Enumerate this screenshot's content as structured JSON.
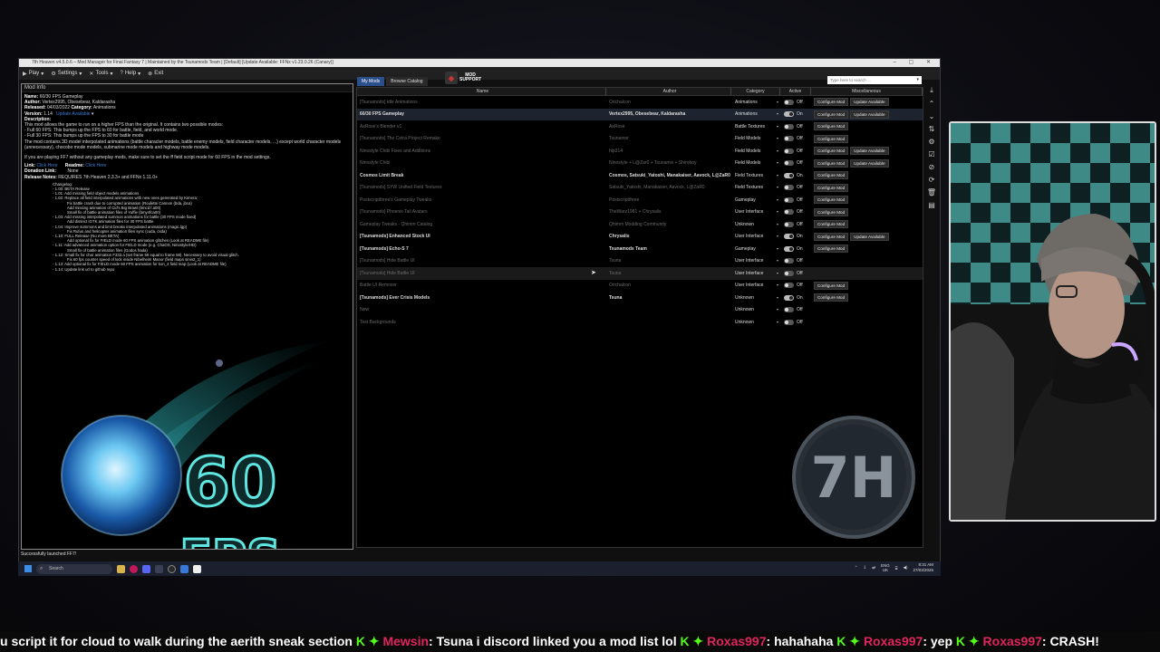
{
  "window": {
    "title": "7th Heaven v4.5.0.6 – Mod Manager for Final Fantasy 7 | Maintained by the Tsunamods Team | [Default] [Update Available: FFNx v1.23.0.26 (Canary)]",
    "menu": [
      {
        "icon": "play-icon",
        "glyph": "▶",
        "label": "Play"
      },
      {
        "icon": "gear-icon",
        "glyph": "⚙",
        "label": "Settings"
      },
      {
        "icon": "tools-icon",
        "glyph": "✕",
        "label": "Tools"
      },
      {
        "icon": "help-icon",
        "glyph": "?",
        "label": "Help"
      },
      {
        "icon": "exit-icon",
        "glyph": "⊗",
        "label": "Exit"
      }
    ]
  },
  "mod_info": {
    "header": "Mod Info",
    "name_label": "Name:",
    "name": "60/30 FPS Gameplay",
    "author_label": "Author:",
    "author": "Vertex2995, Obesebear, Kaldarasha",
    "released_label": "Released:",
    "released": "04/03/2022",
    "category_label": "Category:",
    "category": "Animations",
    "version_label": "Version:",
    "version": "1.14",
    "update": "Update Available",
    "description_label": "Description:",
    "description": [
      "This mod allows the game to run on a higher FPS than the original. It contains two possible modes:",
      "- Full 60 FPS: This bumps up the FPS to 60 for battle, field, and world mode.",
      "- Full 30 FPS: This bumps up the FPS to 30 for battle mode",
      "The mod contains 3D model interpolated animations (battle character models, battle enemy models, field character models, ...) except world character models (unnecessary), chocobo mode models, submarine mode models and highway mode models.",
      "",
      "If you are playing FF7 without any gameplay mods, make sure to set the ff field script mode for 60 FPS in the mod settings."
    ],
    "link_label": "Link:",
    "link": "Click Here",
    "readme_label": "Readme:",
    "readme": "Click Here",
    "donation_label": "Donation Link:",
    "donation": "None",
    "notes_label": "Release Notes:",
    "notes": "REQUIRES 7th Heaven 2.3.3+ and FFNx 1.11.0+",
    "changelog_title": "Changelog:",
    "changelog": [
      {
        "t": "- 1.00: BETA Release",
        "sub": false
      },
      {
        "t": "- 1.01: Add missing field object models animations",
        "sub": false
      },
      {
        "t": "- 1.02: Replace all field interpolated animations with new ones generated by Kimera;",
        "sub": false
      },
      {
        "t": "Fix battle crash due to corrupted animation (Roulette Cannon (bda, jbca)",
        "sub": true
      },
      {
        "t": "Add missing animation of Cid's Big Brawl (bmcd f.a00)",
        "sub": true
      },
      {
        "t": "Small fix of battle animation files of Yuffie (bmy4fca00)",
        "sub": true
      },
      {
        "t": "- 1.03: Add missing interpolated summon animations for battle (30 FPS mode fixed)",
        "sub": false
      },
      {
        "t": "Add distinct IGTK animation files for 30 FPS battle",
        "sub": true
      },
      {
        "t": "- 1.04: Improve summons and limit breaks interpolated animations (magic.lgp)",
        "sub": false
      },
      {
        "t": "Fix Rufus and helicopter animation files sync (cuda, csda)",
        "sub": true
      },
      {
        "t": "- 1.10: FULL Release (No more BETA)",
        "sub": false
      },
      {
        "t": "Add optional fix for FIELD mode 60 FPS animation glitches (Look at README file)",
        "sub": true
      },
      {
        "t": "- 1.11: Add advanced animation option for FIELD mode (e.g. ChaOS, Ninostyle/HD)",
        "sub": false
      },
      {
        "t": "Small fix of battle animation files (Godos hada)",
        "sub": true
      },
      {
        "t": "- 1.12: Small fix for char animation F333.a (set frame 59 equal to frame 58). Necessary to avoid visual glitch.",
        "sub": false
      },
      {
        "t": "Fix 60 fps counter speed of lock inside Nibelheim Manor (field maps sinin2_1)",
        "sub": true
      },
      {
        "t": "- 1.13: Add optional fix for FIELD mode 60 FPS animation for kon_4 field map (Look at README file)",
        "sub": false
      },
      {
        "t": "- 1.14: Update link url to github repo",
        "sub": false
      }
    ],
    "art_text_top": "60",
    "art_text_bottom": "FPS"
  },
  "status": "Successfully launched FF7!",
  "tabs": [
    {
      "label": "My Mods",
      "active": true
    },
    {
      "label": "Browse Catalog",
      "active": false
    }
  ],
  "support": {
    "line1": "MOD",
    "line2": "SUPPORT"
  },
  "search": {
    "placeholder": "Type here to search ..."
  },
  "columns": {
    "name": "Name",
    "author": "Author",
    "category": "Category",
    "active": "Active",
    "misc": "Miscellaneous"
  },
  "rows": [
    {
      "name": "[Tsunamods] Idle Animations",
      "author": "Orichalcon",
      "category": "Animations",
      "on": false,
      "state": "Off",
      "configure": true,
      "update": true
    },
    {
      "name": "60/30 FPS Gameplay",
      "author": "Vertex2995, Obesebear, Kaldarasha",
      "category": "Animations",
      "on": true,
      "state": "On",
      "configure": true,
      "update": true,
      "selected": true
    },
    {
      "name": "AxRose's Blender v1",
      "author": "AxRose",
      "category": "Battle Textures",
      "on": false,
      "state": "Off",
      "configure": true,
      "update": false
    },
    {
      "name": "[Tsunamods] The Cetra Project Remake",
      "author": "Tsunamor",
      "category": "Field Models",
      "on": false,
      "state": "Off",
      "configure": true,
      "update": false
    },
    {
      "name": "Ninostyle Chibi Fixes and Additions",
      "author": "hip314",
      "category": "Field Models",
      "on": false,
      "state": "Off",
      "configure": true,
      "update": true
    },
    {
      "name": "Ninostyle Chibi",
      "author": "Ninostyle + L@Zar0 + Tsunamix + Shiroboy",
      "category": "Field Models",
      "on": false,
      "state": "Off",
      "configure": true,
      "update": true
    },
    {
      "name": "Cosmos Limit Break",
      "author": "Cosmos, Satsuki_Yatoshi, Manakaiser, Aavock, L@ZaR0",
      "category": "Field Textures",
      "on": true,
      "state": "On",
      "configure": true,
      "update": false
    },
    {
      "name": "[Tsunamods] SYW Unified Field Textures",
      "author": "Satsuki_Yatoshi, Manakaiser, Aavock, L@ZaR0",
      "category": "Field Textures",
      "on": false,
      "state": "Off",
      "configure": true,
      "update": false
    },
    {
      "name": "Postscriptthree's Gameplay Tweaks",
      "author": "Postscriptthree",
      "category": "Gameplay",
      "on": false,
      "state": "Off",
      "configure": true,
      "update": false
    },
    {
      "name": "[Tsunamods] Phoenix Tail Avatars",
      "author": "TheWarz1981 + Chrysalis",
      "category": "User Interface",
      "on": false,
      "state": "Off",
      "configure": true,
      "update": false
    },
    {
      "name": "Gameplay Tweaks - Qhimm Catalog",
      "author": "Qhimm Modding Community",
      "category": "Unknown",
      "on": false,
      "state": "Off",
      "configure": true,
      "update": false
    },
    {
      "name": "[Tsunamods] Enhanced Stock UI",
      "author": "Chrysalis",
      "category": "User Interface",
      "on": true,
      "state": "On",
      "configure": true,
      "update": true
    },
    {
      "name": "[Tsunamods] Echo-S 7",
      "author": "Tsunamods Team",
      "category": "Gameplay",
      "on": true,
      "state": "On",
      "configure": true,
      "update": false
    },
    {
      "name": "[Tsunamods] Hide Battle UI",
      "author": "Tsuna",
      "category": "User Interface",
      "on": false,
      "state": "Off",
      "configure": false,
      "update": false
    },
    {
      "name": "[Tsunamods] Hide Battle UI",
      "author": "Tsuna",
      "category": "User Interface",
      "on": false,
      "state": "Off",
      "configure": false,
      "update": false,
      "hover": true
    },
    {
      "name": "Battle UI Remover",
      "author": "Orichalcon",
      "category": "User Interface",
      "on": false,
      "state": "Off",
      "configure": true,
      "update": false
    },
    {
      "name": "[Tsunamods] Ever Crisis Models",
      "author": "Tsuna",
      "category": "Unknown",
      "on": true,
      "state": "On",
      "configure": true,
      "update": false
    },
    {
      "name": "New",
      "author": "",
      "category": "Unknown",
      "on": false,
      "state": "Off",
      "configure": false,
      "update": false
    },
    {
      "name": "Test Backgrounds",
      "author": "",
      "category": "Unknown",
      "on": false,
      "state": "Off",
      "configure": false,
      "update": false
    }
  ],
  "labels": {
    "configure": "Configure Mod",
    "update": "Update Available"
  },
  "side_icons": [
    {
      "name": "download-icon",
      "glyph": "⤓"
    },
    {
      "name": "up-arrow-icon",
      "glyph": "⌃"
    },
    {
      "name": "down-arrow-icon",
      "glyph": "⌄"
    },
    {
      "name": "sort-icon",
      "glyph": "⇅"
    },
    {
      "name": "settings-icon",
      "glyph": "⚙"
    },
    {
      "name": "check-icon",
      "glyph": "☑"
    },
    {
      "name": "block-icon",
      "glyph": "⊘"
    },
    {
      "name": "refresh-icon",
      "glyph": "⟳"
    },
    {
      "name": "delete-icon",
      "glyph": "🗑"
    },
    {
      "name": "save-icon",
      "glyph": "▤"
    }
  ],
  "logo_text": "7H",
  "taskbar": {
    "search": "Search",
    "lang1": "ENG",
    "lang2": "UK",
    "time": "8:31 AM",
    "date": "27/03/2026"
  },
  "chat": [
    {
      "user": "",
      "msg": "u script it for cloud to walk during the aerith sneak section"
    },
    {
      "user": "Mewsin",
      "msg": ": Tsuna i discord linked you a mod list lol"
    },
    {
      "user": "Roxas997",
      "msg": ": hahahaha"
    },
    {
      "user": "Roxas997",
      "msg": ": yep"
    },
    {
      "user": "Roxas997",
      "msg": ": CRASH!"
    }
  ],
  "colors": {
    "accent": "#2b4e8c",
    "chat_user": "#e0245e",
    "chat_icon": "#53fc18"
  }
}
